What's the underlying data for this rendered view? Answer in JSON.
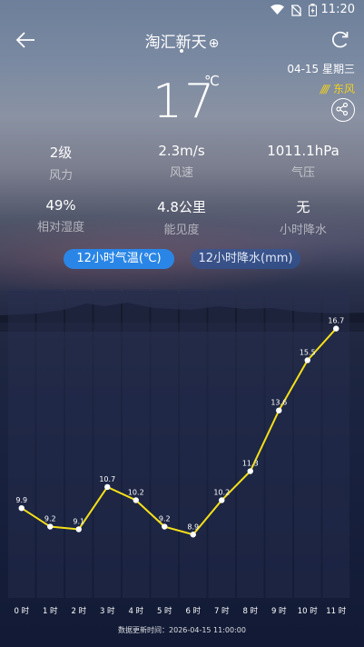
{
  "status_bar": {
    "time": "11:20"
  },
  "header": {
    "city": "淘汇新天",
    "add_icon": "⊕"
  },
  "weather": {
    "date": "04-15 星期三",
    "wind_direction": "东风",
    "temperature": "17",
    "temp_unit": "℃"
  },
  "stats": [
    {
      "value": "2级",
      "label": "风力"
    },
    {
      "value": "2.3m/s",
      "label": "风速"
    },
    {
      "value": "1011.1hPa",
      "label": "气压"
    },
    {
      "value": "49%",
      "label": "相对湿度"
    },
    {
      "value": "4.8公里",
      "label": "能见度"
    },
    {
      "value": "无",
      "label": "小时降水"
    }
  ],
  "tabs": {
    "temp_tab": "12小时气温(℃)",
    "rain_tab": "12小时降水(mm)"
  },
  "chart_data": {
    "type": "line",
    "categories": [
      "0 时",
      "1 时",
      "2 时",
      "3 时",
      "4 时",
      "5 时",
      "6 时",
      "7 时",
      "8 时",
      "9 时",
      "10 时",
      "11 时"
    ],
    "values": [
      9.9,
      9.2,
      9.1,
      10.7,
      10.2,
      9.2,
      8.9,
      10.2,
      11.3,
      13.6,
      15.5,
      16.7
    ],
    "value_labels": [
      "9.9",
      "9.2",
      "9.1",
      "10.7",
      "10.2",
      "9.2",
      "8.9",
      "10.2",
      "11.3",
      "13.6",
      "15.5",
      "16.7"
    ],
    "ylim": [
      6.5,
      18.2
    ],
    "line_color": "#f5e018"
  },
  "footer": {
    "update_time": "数据更新时间：2026-04-15 11:00:00"
  }
}
